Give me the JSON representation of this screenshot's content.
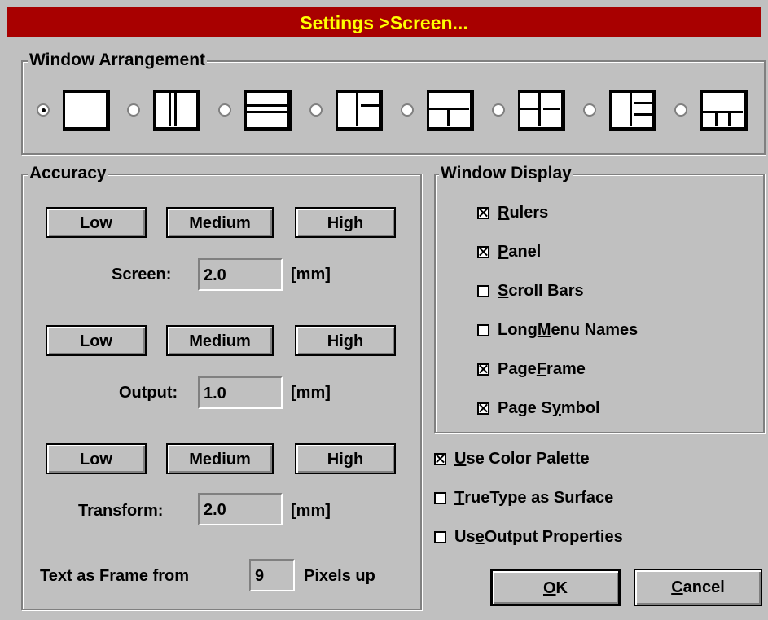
{
  "dialog": {
    "title": "Settings >Screen..."
  },
  "window_arrangement": {
    "label": "Window Arrangement",
    "selected_index": 0,
    "options": [
      "single",
      "two-vertical",
      "two-horizontal",
      "left-plus-right-stack",
      "top-plus-bottom-pair",
      "grid-2x2",
      "left-plus-right-three",
      "top-plus-bottom-three"
    ]
  },
  "accuracy": {
    "label": "Accuracy",
    "buttons": {
      "low": "Low",
      "medium": "Medium",
      "high": "High"
    },
    "screen": {
      "label": "Screen:",
      "value": "2.0",
      "unit": "[mm]"
    },
    "output": {
      "label": "Output:",
      "value": "1.0",
      "unit": "[mm]"
    },
    "transform": {
      "label": "Transform:",
      "value": "2.0",
      "unit": "[mm]"
    },
    "text_frame": {
      "prefix": "Text as Frame from",
      "value": "9",
      "suffix": "Pixels up"
    }
  },
  "window_display": {
    "label": "Window Display",
    "items": [
      {
        "pre": "",
        "ul": "R",
        "post": "ulers",
        "checked": true
      },
      {
        "pre": "",
        "ul": "P",
        "post": "anel",
        "checked": true
      },
      {
        "pre": "",
        "ul": "S",
        "post": "croll Bars",
        "checked": false
      },
      {
        "pre": "Long ",
        "ul": "M",
        "post": "enu Names",
        "checked": false
      },
      {
        "pre": "Page ",
        "ul": "F",
        "post": "rame",
        "checked": true
      },
      {
        "pre": "Page S",
        "ul": "y",
        "post": "mbol",
        "checked": true
      }
    ]
  },
  "options": [
    {
      "pre": "",
      "ul": "U",
      "post": "se Color Palette",
      "checked": true
    },
    {
      "pre": "",
      "ul": "T",
      "post": "rueType as Surface",
      "checked": false
    },
    {
      "pre": "Us",
      "ul": "e",
      "post": " Output Properties",
      "checked": false
    }
  ],
  "buttons": {
    "ok": {
      "ul": "O",
      "post": "K"
    },
    "cancel": {
      "ul": "C",
      "post": "ancel"
    }
  }
}
